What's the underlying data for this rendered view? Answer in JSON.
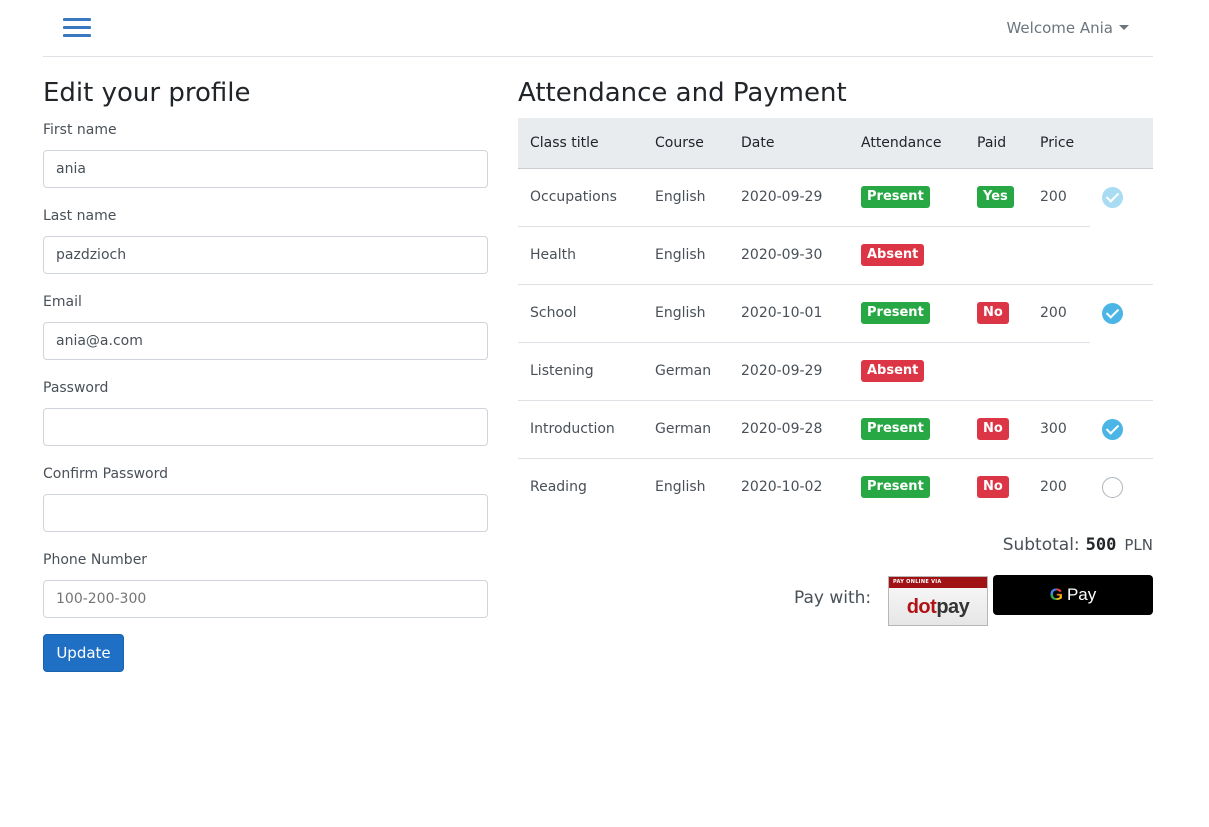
{
  "navbar": {
    "welcome_label": "Welcome Ania"
  },
  "profile": {
    "title": "Edit your profile",
    "fields": {
      "first_name": {
        "label": "First name",
        "value": "ania"
      },
      "last_name": {
        "label": "Last name",
        "value": "pazdzioch"
      },
      "email": {
        "label": "Email",
        "value": "ania@a.com"
      },
      "password": {
        "label": "Password",
        "value": ""
      },
      "confirm_password": {
        "label": "Confirm Password",
        "value": ""
      },
      "phone": {
        "label": "Phone Number",
        "placeholder": "100-200-300"
      }
    },
    "update_label": "Update"
  },
  "attendance": {
    "title": "Attendance and Payment",
    "columns": [
      "Class title",
      "Course",
      "Date",
      "Attendance",
      "Paid",
      "Price"
    ],
    "rows": [
      {
        "class_title": "Occupations",
        "course": "English",
        "date": "2020-09-29",
        "attendance": "Present",
        "paid": "Yes",
        "price": "200",
        "check": "faded"
      },
      {
        "class_title": "Health",
        "course": "English",
        "date": "2020-09-30",
        "attendance": "Absent",
        "paid": "",
        "price": "",
        "check": ""
      },
      {
        "class_title": "School",
        "course": "English",
        "date": "2020-10-01",
        "attendance": "Present",
        "paid": "No",
        "price": "200",
        "check": "on"
      },
      {
        "class_title": "Listening",
        "course": "German",
        "date": "2020-09-29",
        "attendance": "Absent",
        "paid": "",
        "price": "",
        "check": ""
      },
      {
        "class_title": "Introduction",
        "course": "German",
        "date": "2020-09-28",
        "attendance": "Present",
        "paid": "No",
        "price": "300",
        "check": "on"
      },
      {
        "class_title": "Reading",
        "course": "English",
        "date": "2020-10-02",
        "attendance": "Present",
        "paid": "No",
        "price": "200",
        "check": "off"
      }
    ],
    "subtotal_label": "Subtotal:",
    "subtotal_value": "500",
    "currency": "PLN",
    "pay_with_label": "Pay with:",
    "dotpay": {
      "strip_text": "PAY ONLINE VIA",
      "logo_text": "dotpay"
    },
    "gpay_label": "Pay"
  },
  "colors": {
    "primary": "#1f6fc4",
    "present": "#28a745",
    "absent": "#dc3545",
    "check": "#4bb5e6"
  }
}
